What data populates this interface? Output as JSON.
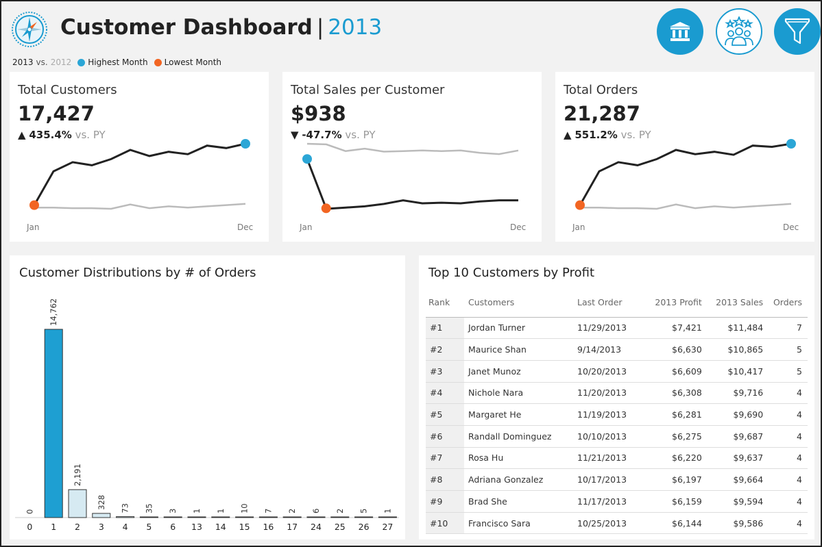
{
  "header": {
    "title": "Customer Dashboard",
    "separator": "|",
    "year": "2013",
    "legend": {
      "current": "2013",
      "vs": "vs.",
      "prior": "2012",
      "highest": "Highest Month",
      "lowest": "Lowest Month"
    },
    "icons": [
      "compass-logo-icon",
      "bank-icon",
      "people-stars-icon",
      "filter-icon"
    ]
  },
  "colors": {
    "accent": "#1a9bd0",
    "highest": "#2ba6d6",
    "lowest": "#f26522",
    "current_line": "#222222",
    "prior_line": "#bbbbbb",
    "bar_highlight": "#1e9fd2",
    "bar_light": "#d6eaf2"
  },
  "kpis": [
    {
      "label": "Total Customers",
      "value": "17,427",
      "arrow": "▲",
      "change": "435.4%",
      "vs": "vs. PY",
      "x_start": "Jan",
      "x_end": "Dec",
      "current": [
        5,
        60,
        75,
        70,
        80,
        95,
        85,
        92,
        88,
        102,
        98,
        105
      ],
      "prior": [
        1,
        1,
        0,
        0,
        -1,
        6,
        0,
        3,
        1,
        3,
        5,
        7
      ],
      "high_index": 11,
      "low_index": 0
    },
    {
      "label": "Total Sales per Customer",
      "value": "$938",
      "arrow": "▼",
      "change": "-47.7%",
      "vs": "vs. PY",
      "x_start": "Jan",
      "x_end": "Dec",
      "current": [
        100,
        18,
        20,
        22,
        26,
        32,
        27,
        28,
        27,
        30,
        32,
        32
      ],
      "prior": [
        125,
        124,
        113,
        117,
        112,
        113,
        114,
        113,
        114,
        110,
        108,
        114
      ],
      "high_index": 0,
      "low_index": 0.99
    },
    {
      "label": "Total Orders",
      "value": "21,287",
      "arrow": "▲",
      "change": "551.2%",
      "vs": "vs. PY",
      "x_start": "Jan",
      "x_end": "Dec",
      "current": [
        5,
        60,
        75,
        70,
        80,
        95,
        88,
        92,
        87,
        102,
        100,
        105
      ],
      "prior": [
        1,
        1,
        0,
        0,
        -1,
        6,
        0,
        3,
        1,
        3,
        5,
        7
      ],
      "high_index": 11,
      "low_index": 0
    }
  ],
  "distribution": {
    "title": "Customer Distributions by # of Orders"
  },
  "chart_data": {
    "type": "bar",
    "title": "Customer Distributions by # of Orders",
    "categories": [
      "0",
      "1",
      "2",
      "3",
      "4",
      "5",
      "6",
      "13",
      "14",
      "15",
      "16",
      "17",
      "24",
      "25",
      "26",
      "27"
    ],
    "values": [
      0,
      14762,
      2191,
      328,
      73,
      35,
      3,
      1,
      1,
      10,
      7,
      2,
      6,
      2,
      5,
      1
    ],
    "labels": [
      "0",
      "14,762",
      "2,191",
      "328",
      "73",
      "35",
      "3",
      "1",
      "1",
      "10",
      "7",
      "2",
      "6",
      "2",
      "5",
      "1"
    ],
    "highlight_index": 1,
    "ylim": [
      0,
      16000
    ]
  },
  "top10": {
    "title": "Top 10 Customers by Profit",
    "columns": [
      "Rank",
      "Customers",
      "Last Order",
      "2013 Profit",
      "2013 Sales",
      "Orders"
    ],
    "rows": [
      [
        "#1",
        "Jordan Turner",
        "11/29/2013",
        "$7,421",
        "$11,484",
        "7"
      ],
      [
        "#2",
        "Maurice Shan",
        "9/14/2013",
        "$6,630",
        "$10,865",
        "5"
      ],
      [
        "#3",
        "Janet Munoz",
        "10/20/2013",
        "$6,609",
        "$10,417",
        "5"
      ],
      [
        "#4",
        "Nichole Nara",
        "11/20/2013",
        "$6,308",
        "$9,716",
        "4"
      ],
      [
        "#5",
        "Margaret He",
        "11/19/2013",
        "$6,281",
        "$9,690",
        "4"
      ],
      [
        "#6",
        "Randall Dominguez",
        "10/10/2013",
        "$6,275",
        "$9,687",
        "4"
      ],
      [
        "#7",
        "Rosa Hu",
        "11/21/2013",
        "$6,220",
        "$9,637",
        "4"
      ],
      [
        "#8",
        "Adriana Gonzalez",
        "10/17/2013",
        "$6,197",
        "$9,664",
        "4"
      ],
      [
        "#9",
        "Brad She",
        "11/17/2013",
        "$6,159",
        "$9,594",
        "4"
      ],
      [
        "#10",
        "Francisco Sara",
        "10/25/2013",
        "$6,144",
        "$9,586",
        "4"
      ]
    ]
  }
}
